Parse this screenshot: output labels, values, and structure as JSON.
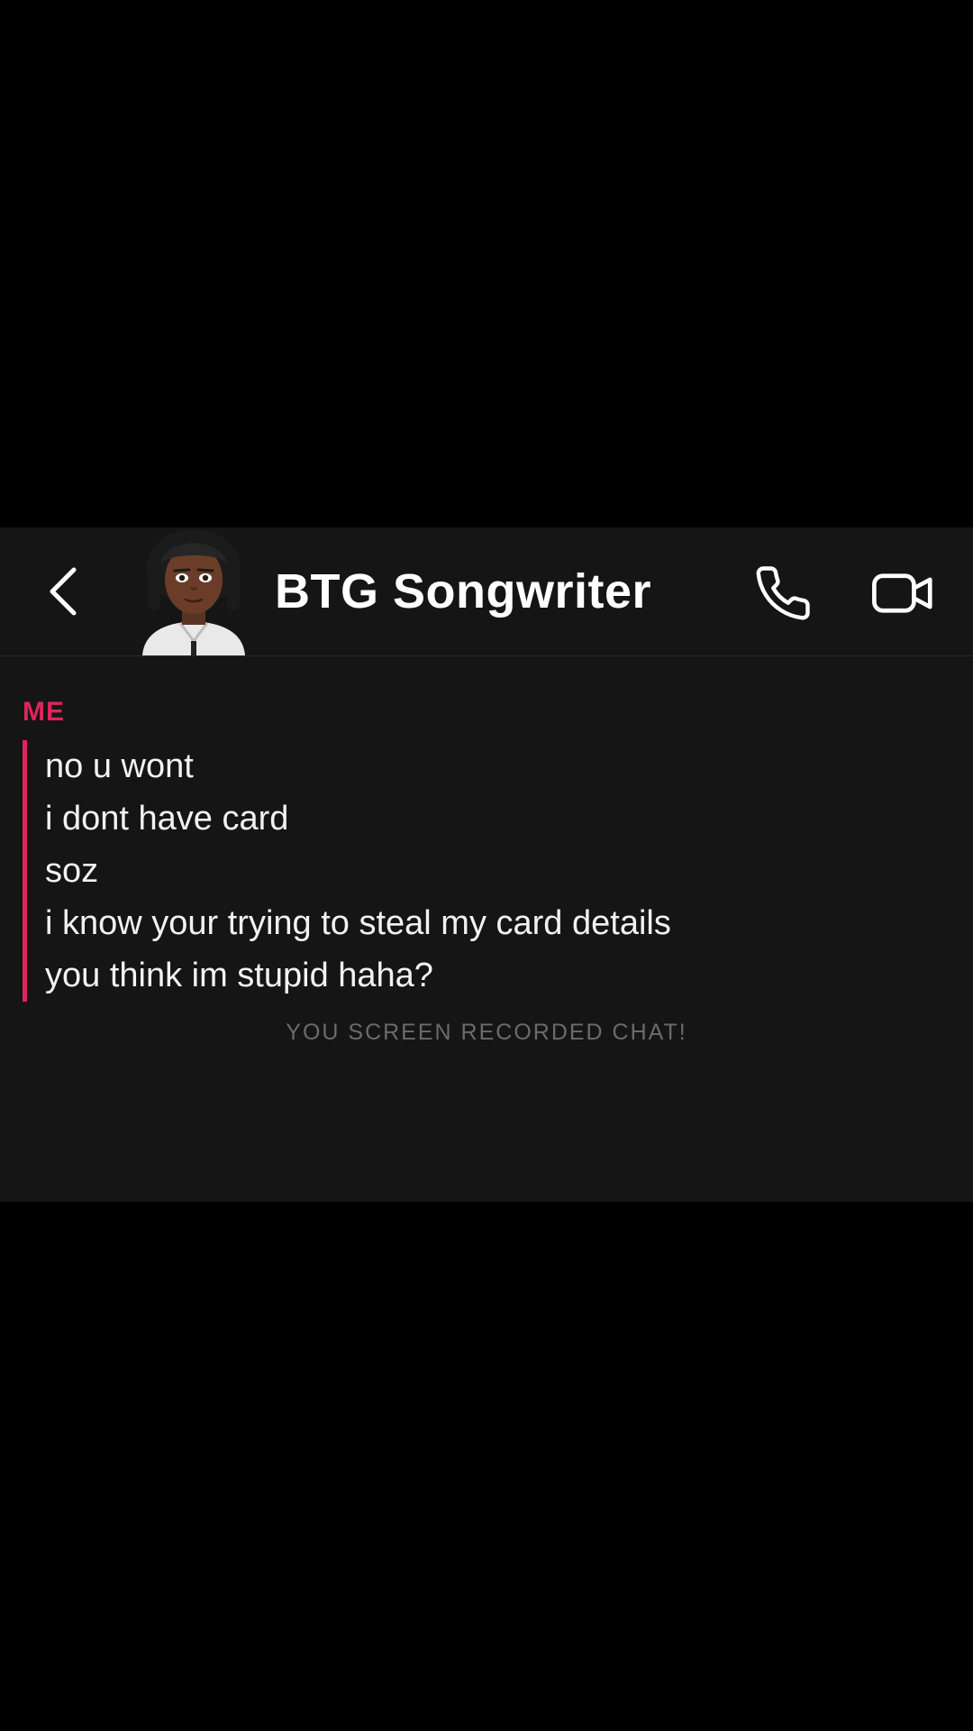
{
  "header": {
    "back_icon": "chevron-left-icon",
    "contact_name": "BTG Songwriter",
    "call_icon": "phone-icon",
    "video_icon": "video-camera-icon"
  },
  "chat": {
    "sender": "ME",
    "accent_color": "#e0245e",
    "messages": [
      "no u wont",
      "i dont have card",
      "soz",
      "i know your trying to steal my card details",
      "you think im stupid haha?"
    ],
    "system_notice": "YOU SCREEN RECORDED CHAT!"
  }
}
